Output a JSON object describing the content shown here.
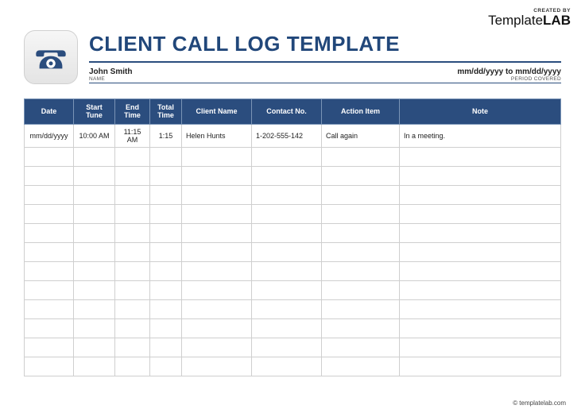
{
  "brand": {
    "created_by": "CREATED BY",
    "logo_light": "Template",
    "logo_bold": "LAB"
  },
  "title": "CLIENT CALL LOG TEMPLATE",
  "meta": {
    "name_value": "John Smith",
    "name_label": "NAME",
    "period_value": "mm/dd/yyyy to mm/dd/yyyy",
    "period_label": "PERIOD COVERED"
  },
  "columns": {
    "date": "Date",
    "start": "Start\nTune",
    "end": "End\nTime",
    "total": "Total\nTime",
    "client": "Client Name",
    "contact": "Contact No.",
    "action": "Action Item",
    "note": "Note"
  },
  "rows": [
    {
      "date": "mm/dd/yyyy",
      "start": "10:00 AM",
      "end": "11:15 AM",
      "total": "1:15",
      "client": "Helen Hunts",
      "contact": "1-202-555-142",
      "action": "Call again",
      "note": "In a meeting."
    },
    {
      "date": "",
      "start": "",
      "end": "",
      "total": "",
      "client": "",
      "contact": "",
      "action": "",
      "note": ""
    },
    {
      "date": "",
      "start": "",
      "end": "",
      "total": "",
      "client": "",
      "contact": "",
      "action": "",
      "note": ""
    },
    {
      "date": "",
      "start": "",
      "end": "",
      "total": "",
      "client": "",
      "contact": "",
      "action": "",
      "note": ""
    },
    {
      "date": "",
      "start": "",
      "end": "",
      "total": "",
      "client": "",
      "contact": "",
      "action": "",
      "note": ""
    },
    {
      "date": "",
      "start": "",
      "end": "",
      "total": "",
      "client": "",
      "contact": "",
      "action": "",
      "note": ""
    },
    {
      "date": "",
      "start": "",
      "end": "",
      "total": "",
      "client": "",
      "contact": "",
      "action": "",
      "note": ""
    },
    {
      "date": "",
      "start": "",
      "end": "",
      "total": "",
      "client": "",
      "contact": "",
      "action": "",
      "note": ""
    },
    {
      "date": "",
      "start": "",
      "end": "",
      "total": "",
      "client": "",
      "contact": "",
      "action": "",
      "note": ""
    },
    {
      "date": "",
      "start": "",
      "end": "",
      "total": "",
      "client": "",
      "contact": "",
      "action": "",
      "note": ""
    },
    {
      "date": "",
      "start": "",
      "end": "",
      "total": "",
      "client": "",
      "contact": "",
      "action": "",
      "note": ""
    },
    {
      "date": "",
      "start": "",
      "end": "",
      "total": "",
      "client": "",
      "contact": "",
      "action": "",
      "note": ""
    },
    {
      "date": "",
      "start": "",
      "end": "",
      "total": "",
      "client": "",
      "contact": "",
      "action": "",
      "note": ""
    }
  ],
  "footer": "© templatelab.com"
}
